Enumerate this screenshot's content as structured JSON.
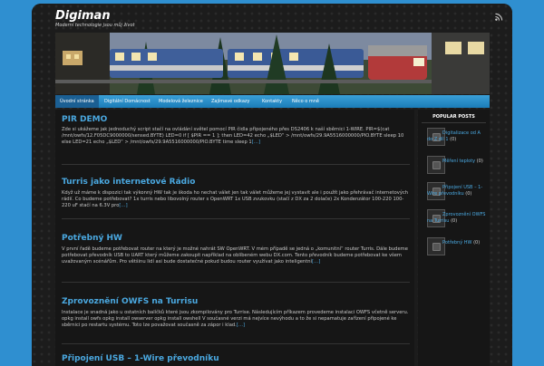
{
  "site": {
    "title": "Digiman",
    "tagline": "Moderní technologie jsou můj život"
  },
  "nav": {
    "items": [
      {
        "label": "Úvodní stránka",
        "active": true
      },
      {
        "label": "Digitální Domácnost"
      },
      {
        "label": "Modelová železnice"
      },
      {
        "label": "Zajímavé odkazy"
      },
      {
        "label": "Kontakty"
      },
      {
        "label": "Něco o mně"
      }
    ]
  },
  "posts": [
    {
      "title": "PIR DEMO",
      "text": "Zde si ukážeme jak jednoduchý script stačí na ovládání světel pomocí PIR čidla připojeného přes DS2406 k naší sběrnici 1-WIRE.   PIR=$(cat /mnt/owfs/12.F05DC9000000/sensed.BYTE) LED=0 if [ $PIR == 1 ]; then   LED=42   echo „$LED“ > /mnt/owfs/29.9A5516000000/PIO.BYTE   sleep 10 else   LED=21   echo „$LED“ > /mnt/owfs/29.9A5516000000/PIO.BYTE time sleep 1",
      "more": "[…]"
    },
    {
      "title": "Turris jako internetové Rádio",
      "text": "Když už máme k dispozici tak výkonný HW tak je škoda ho nechat válet jen tak válet můžeme jej vystavit ale i použít jako přehrávač internetových rádií. Co budeme potřebovat? 1x turris nebo libovolný router s OpenWRT 1x USB zvukovku (stačí z DX za 2 dolače) 2x Kondenzátor 100-220 100-220 uF  stačí na 6.3V pro",
      "more": "[…]"
    },
    {
      "title": "Potřebný HW",
      "text": "V první řadě budeme potřebovat router na který je možné nahrát SW OpenWRT. V mém případě se jedná o „komunitní“ router Turris. Dále budeme potřebovat převodník USB to UART který můžeme zakoupit například na oblíbeném webu DX.com. Tento převodník budeme potřebovat ke všem uvažovaným scénářům. Pro většinu lidí asi bude dostatečné pokud budou router využívat jako inteligentní",
      "more": "[…]"
    },
    {
      "title": "Zprovoznění OWFS na Turrisu",
      "text": "Instalace je snadná jako u ostatních balíčků které jsou zkompilovány pro Turrise. Následujícím příkazem provedeme instalaci OWFS včetně serveru. opkg install owfs opkg install owserver opkg install owshell   V současné verzi má nejvíce nevýhodu a to že si nepamatuje zařízení připojené ke sběrnici po restartu systému. Toto lze považovat současně za zápor i klad.",
      "more": "[…]"
    },
    {
      "title": "Připojení USB – 1-Wire převodníku",
      "text": "",
      "more": ""
    }
  ],
  "sidebar": {
    "title": "POPULAR POSTS",
    "items": [
      {
        "label": "Digitalizace od A do Z díl 1",
        "count": "(0)"
      },
      {
        "label": "Měření teploty",
        "count": "(0)"
      },
      {
        "label": "Připojení USB – 1-Wire převodníku",
        "count": "(0)"
      },
      {
        "label": "Zprovoznění OWFS na Turrisu",
        "count": "(0)"
      },
      {
        "label": "Potřebný HW",
        "count": "(0)"
      }
    ]
  }
}
